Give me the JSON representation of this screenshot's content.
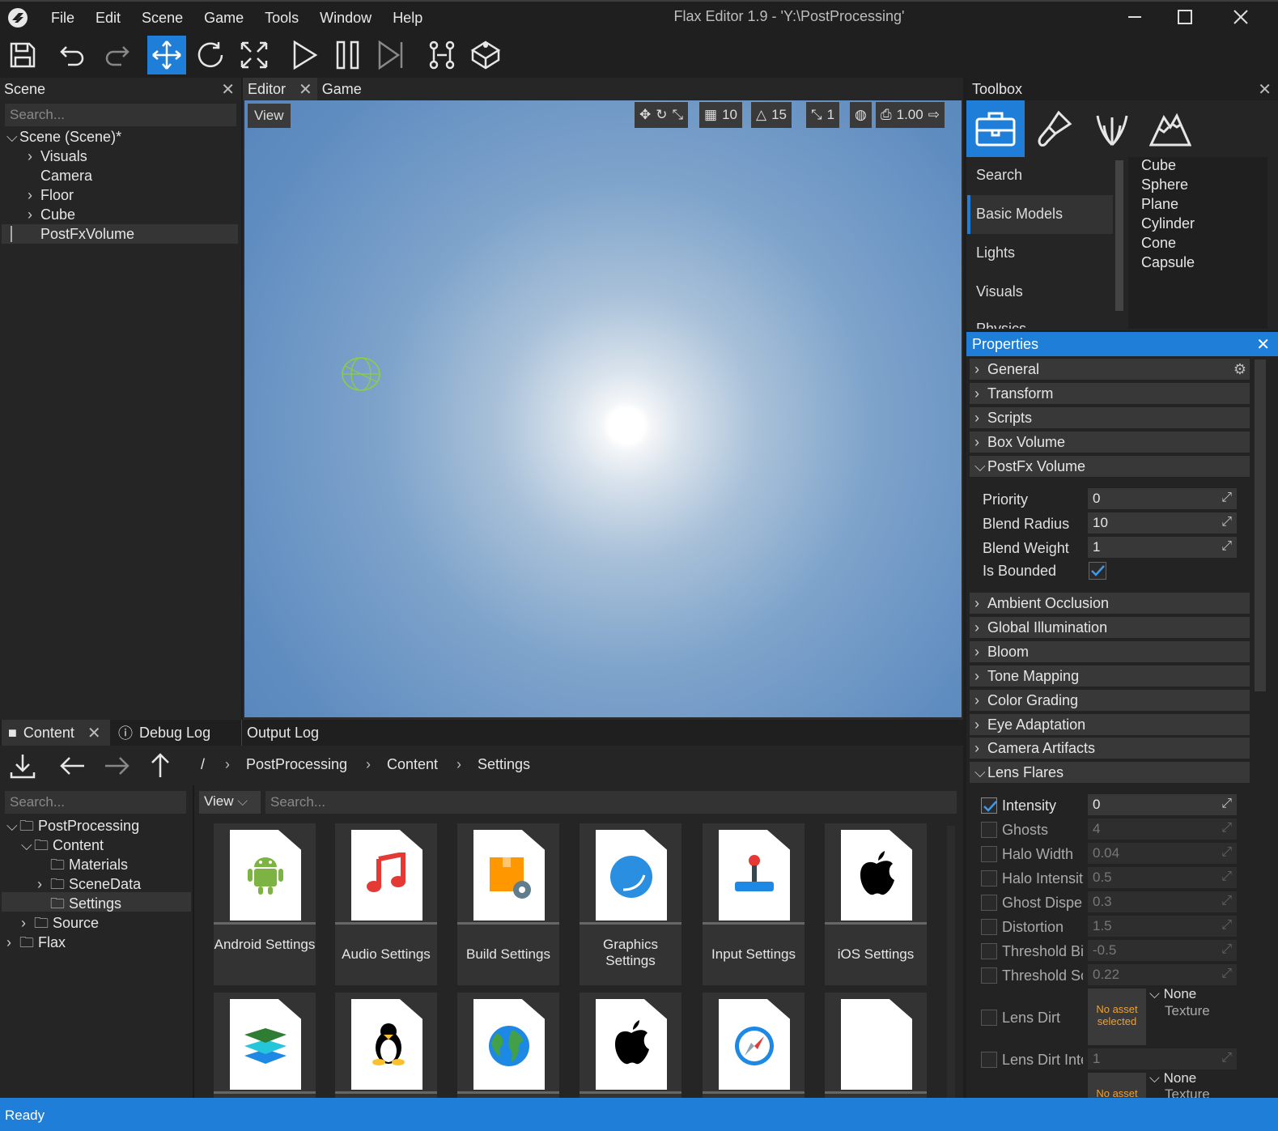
{
  "window": {
    "title": "Flax Editor 1.9 - 'Y:\\PostProcessing'",
    "menu": [
      "File",
      "Edit",
      "Scene",
      "Game",
      "Tools",
      "Window",
      "Help"
    ]
  },
  "toolbar": {
    "icons": [
      "save-icon",
      "undo-icon",
      "redo-icon",
      "translate-icon",
      "rotate-icon",
      "scale-icon",
      "play-icon",
      "pause-icon",
      "step-icon",
      "build-icon",
      "cook-icon"
    ],
    "active": "translate-icon"
  },
  "scene": {
    "tab": "Scene",
    "search_placeholder": "Search...",
    "tree": [
      {
        "label": "Scene (Scene)*",
        "expanded": true
      },
      {
        "label": "Visuals",
        "collapsed": true
      },
      {
        "label": "Camera"
      },
      {
        "label": "Floor",
        "collapsed": true
      },
      {
        "label": "Cube",
        "collapsed": true
      },
      {
        "label": "PostFxVolume",
        "selected": true
      }
    ]
  },
  "viewport": {
    "tabs": [
      "Editor",
      "Game"
    ],
    "view_button": "View",
    "grid_snap": "10",
    "angle_snap": "15",
    "scale_snap": "1",
    "cam_speed": "1.00"
  },
  "toolbox": {
    "title": "Toolbox",
    "categories": [
      "Search",
      "Basic Models",
      "Lights",
      "Visuals",
      "Physics"
    ],
    "selected_category": "Basic Models",
    "models": [
      "Cube",
      "Sphere",
      "Plane",
      "Cylinder",
      "Cone",
      "Capsule"
    ]
  },
  "properties": {
    "title": "Properties",
    "groups_top": [
      "General",
      "Transform",
      "Scripts",
      "Box Volume"
    ],
    "postfx": {
      "title": "PostFx Volume",
      "priority_label": "Priority",
      "priority": "0",
      "blend_radius_label": "Blend Radius",
      "blend_radius": "10",
      "blend_weight_label": "Blend Weight",
      "blend_weight": "1",
      "is_bounded_label": "Is Bounded",
      "is_bounded": true
    },
    "groups_mid": [
      "Ambient Occlusion",
      "Global Illumination",
      "Bloom",
      "Tone Mapping",
      "Color Grading",
      "Eye Adaptation",
      "Camera Artifacts"
    ],
    "lens_flares": {
      "title": "Lens Flares",
      "rows": [
        {
          "label": "Intensity",
          "value": "0",
          "checked": true
        },
        {
          "label": "Ghosts",
          "value": "4",
          "checked": false
        },
        {
          "label": "Halo Width",
          "value": "0.04",
          "checked": false
        },
        {
          "label": "Halo Intensity",
          "value": "0.5",
          "checked": false
        },
        {
          "label": "Ghost Dispersal",
          "value": "0.3",
          "checked": false
        },
        {
          "label": "Distortion",
          "value": "1.5",
          "checked": false
        },
        {
          "label": "Threshold Bias",
          "value": "-0.5",
          "checked": false
        },
        {
          "label": "Threshold Scale",
          "value": "0.22",
          "checked": false
        }
      ],
      "lens_dirt_label": "Lens Dirt",
      "no_asset": "No asset selected",
      "none_label": "None",
      "texture_label": "Texture",
      "lens_dirt_intensity_label": "Lens Dirt Intensity",
      "lens_dirt_intensity": "1"
    }
  },
  "content": {
    "tabs": [
      "Content",
      "Debug Log",
      "Output Log"
    ],
    "breadcrumb": [
      "/",
      "PostProcessing",
      "Content",
      "Settings"
    ],
    "search_placeholder": "Search...",
    "view_button": "View",
    "tree": [
      {
        "label": "PostProcessing",
        "depth": 0
      },
      {
        "label": "Content",
        "depth": 1
      },
      {
        "label": "Materials",
        "depth": 2
      },
      {
        "label": "SceneData",
        "depth": 2
      },
      {
        "label": "Settings",
        "depth": 2,
        "selected": true
      },
      {
        "label": "Source",
        "depth": 1
      },
      {
        "label": "Flax",
        "depth": 0
      }
    ],
    "tiles": [
      {
        "label": "Android Settings",
        "icon": "android-icon"
      },
      {
        "label": "Audio Settings",
        "icon": "music-note-icon"
      },
      {
        "label": "Build Settings",
        "icon": "build-box-icon"
      },
      {
        "label": "Graphics Settings",
        "icon": "graphics-circle-icon"
      },
      {
        "label": "Input Settings",
        "icon": "joystick-icon"
      },
      {
        "label": "iOS Settings",
        "icon": "apple-icon"
      }
    ],
    "tiles_row2": [
      "layers-icon",
      "linux-icon",
      "globe-icon",
      "apple-icon",
      "compass-icon",
      "blank-doc-icon"
    ]
  },
  "status": "Ready",
  "colors": {
    "accent": "#1e7ed8",
    "panel": "#252525"
  }
}
